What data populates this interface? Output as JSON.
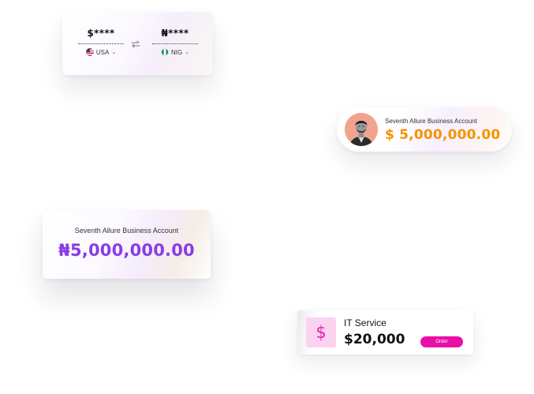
{
  "converter": {
    "from": {
      "amount": "$****",
      "currency": "USA",
      "flag_icon": "us-flag-icon"
    },
    "to": {
      "amount": "₦****",
      "currency": "NIG",
      "flag_icon": "nigeria-flag-icon"
    },
    "swap_icon": "swap-arrows-icon"
  },
  "profile_card": {
    "account_name": "Seventh Allure Business Account",
    "balance": "$ 5,000,000.00",
    "balance_color": "#f59300",
    "avatar_bg": "#f2a38f"
  },
  "naira_card": {
    "account_name": "Seventh Allure Business Account",
    "balance": "₦5,000,000.00",
    "balance_color": "#8a3ce6"
  },
  "service_card": {
    "icon_glyph": "$",
    "title": "IT Service",
    "price": "$20,000",
    "order_label": "Order",
    "accent_color": "#e80fa8"
  }
}
